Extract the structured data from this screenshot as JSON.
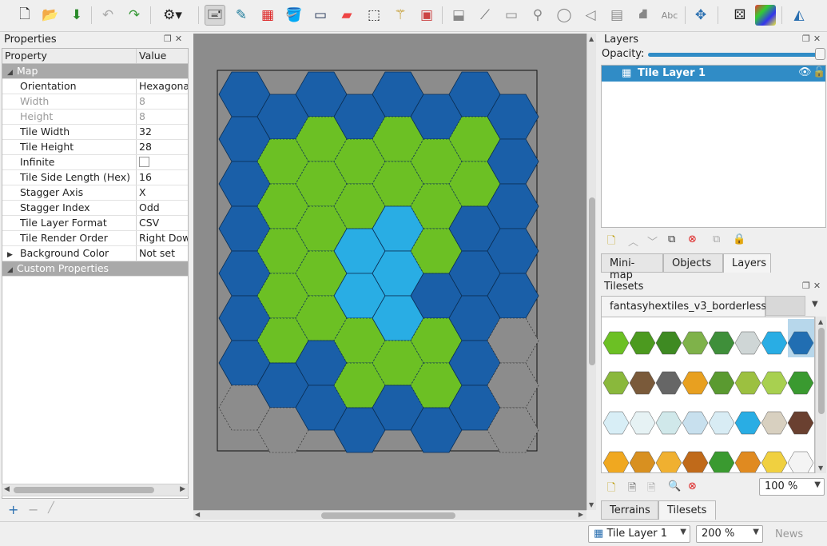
{
  "toolbar": {
    "icons": [
      "new-icon",
      "open-icon",
      "save-icon",
      "undo-icon",
      "redo-icon",
      "commands-icon",
      "stamp-brush-icon",
      "terrain-brush-icon",
      "wang-brush-icon",
      "bucket-fill-icon",
      "shape-fill-icon",
      "eraser-icon",
      "rect-select-icon",
      "magic-wand-icon",
      "select-same-tile-icon",
      "select-objects-icon",
      "edit-polygons-icon",
      "insert-rectangle-icon",
      "insert-point-icon",
      "insert-ellipse-icon",
      "insert-polygon-icon",
      "insert-tile-icon",
      "insert-template-icon",
      "insert-text-icon",
      "move-icon",
      "random-mode-icon",
      "wang-fill-icon",
      "flip-icon"
    ]
  },
  "properties": {
    "title": "Properties",
    "col_property": "Property",
    "col_value": "Value",
    "rows": [
      {
        "key": "Map",
        "value": "",
        "type": "group"
      },
      {
        "key": "Orientation",
        "value": "Hexagonal"
      },
      {
        "key": "Width",
        "value": "8",
        "disabled": true
      },
      {
        "key": "Height",
        "value": "8",
        "disabled": true
      },
      {
        "key": "Tile Width",
        "value": "32"
      },
      {
        "key": "Tile Height",
        "value": "28"
      },
      {
        "key": "Infinite",
        "value": "",
        "checkbox": true
      },
      {
        "key": "Tile Side Length (Hex)",
        "value": "16"
      },
      {
        "key": "Stagger Axis",
        "value": "X"
      },
      {
        "key": "Stagger Index",
        "value": "Odd"
      },
      {
        "key": "Tile Layer Format",
        "value": "CSV"
      },
      {
        "key": "Tile Render Order",
        "value": "Right Down"
      },
      {
        "key": "Background Color",
        "value": "Not set",
        "expandable": true
      },
      {
        "key": "Custom Properties",
        "value": "",
        "type": "group"
      }
    ]
  },
  "layers": {
    "title": "Layers",
    "opacity_label": "Opacity:",
    "opacity": 1.0,
    "items": [
      {
        "name": "Tile Layer 1",
        "visible": true
      }
    ],
    "tabs": [
      "Mini-map",
      "Objects",
      "Layers"
    ],
    "selected_tab": "Layers"
  },
  "tilesets": {
    "title": "Tilesets",
    "active": "fantasyhextiles_v3_borderless",
    "zoom": "100 %",
    "tabs": [
      "Terrains",
      "Tilesets"
    ],
    "selected_tab": "Tilesets"
  },
  "statusbar": {
    "layer": "Tile Layer 1",
    "zoom": "200 %",
    "news": "News"
  },
  "colors": {
    "water": "#1a5fa8",
    "grass": "#6cc024",
    "lake": "#29ade4",
    "empty": "#8c8c8c",
    "selection": "#308cc6"
  },
  "map_grid": {
    "columns": 8,
    "rows": 8,
    "tiles": [
      [
        "W",
        "W",
        "W",
        "W",
        "W",
        "W",
        "W",
        "W"
      ],
      [
        "W",
        "G",
        "G",
        "G",
        "G",
        "G",
        "G",
        "W"
      ],
      [
        "W",
        "G",
        "G",
        "G",
        "G",
        "G",
        "G",
        "W"
      ],
      [
        "W",
        "G",
        "G",
        "L",
        "L",
        "G",
        "W",
        "W"
      ],
      [
        "W",
        "G",
        "G",
        "L",
        "L",
        "W",
        "W",
        "W"
      ],
      [
        "W",
        "G",
        "G",
        "G",
        "L",
        "G",
        "W",
        "E"
      ],
      [
        "W",
        "W",
        "W",
        "G",
        "G",
        "G",
        "W",
        "E"
      ],
      [
        "E",
        "E",
        "W",
        "W",
        "W",
        "W",
        "W",
        "E"
      ]
    ]
  }
}
